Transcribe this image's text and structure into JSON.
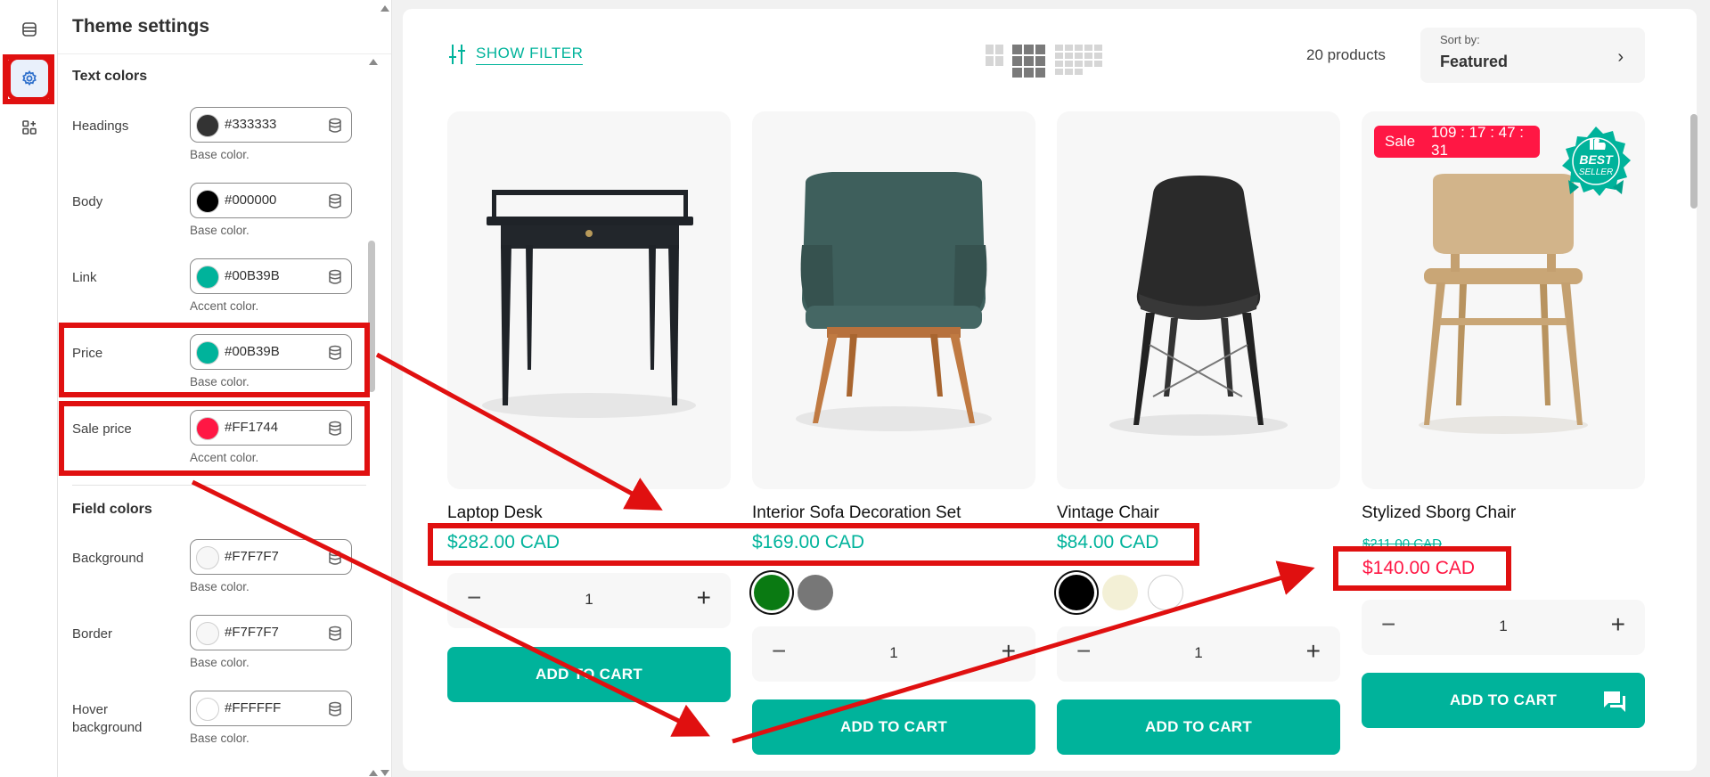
{
  "rail": {
    "icons": [
      "sections-icon",
      "theme-settings-icon",
      "app-blocks-icon"
    ]
  },
  "panel": {
    "title": "Theme settings",
    "text_colors_title": "Text colors",
    "text_colors": [
      {
        "label": "Headings",
        "value": "#333333",
        "hint": "Base color.",
        "color": "#333333"
      },
      {
        "label": "Body",
        "value": "#000000",
        "hint": "Base color.",
        "color": "#000000"
      },
      {
        "label": "Link",
        "value": "#00B39B",
        "hint": "Accent color.",
        "color": "#00B39B"
      },
      {
        "label": "Price",
        "value": "#00B39B",
        "hint": "Base color.",
        "color": "#00B39B"
      },
      {
        "label": "Sale price",
        "value": "#FF1744",
        "hint": "Accent color.",
        "color": "#FF1744"
      }
    ],
    "field_colors_title": "Field colors",
    "field_colors": [
      {
        "label": "Background",
        "value": "#F7F7F7",
        "hint": "Base color.",
        "color": "#F7F7F7"
      },
      {
        "label": "Border",
        "value": "#F7F7F7",
        "hint": "Base color.",
        "color": "#F7F7F7"
      },
      {
        "label": "Hover background",
        "value": "#FFFFFF",
        "hint": "Base color.",
        "color": "#FFFFFF"
      }
    ]
  },
  "toolbar": {
    "filter_label": "SHOW FILTER",
    "count": "20 products",
    "sort_label": "Sort by:",
    "sort_value": "Featured"
  },
  "products": [
    {
      "title": "Laptop Desk",
      "price": "$282.00 CAD",
      "qty": "1",
      "cta": "ADD TO CART"
    },
    {
      "title": "Interior Sofa Decoration Set",
      "price": "$169.00 CAD",
      "qty": "1",
      "cta": "ADD TO CART",
      "swatches": [
        "#0a7a12",
        "#777777"
      ]
    },
    {
      "title": "Vintage Chair",
      "price": "$84.00 CAD",
      "qty": "1",
      "cta": "ADD TO CART",
      "swatches": [
        "#000000",
        "#f3f0d6",
        "#ffffff"
      ]
    },
    {
      "title": "Stylized Sborg Chair",
      "old_price": "$211.00 CAD",
      "sale_price": "$140.00 CAD",
      "qty": "1",
      "cta": "ADD TO CART",
      "badge_label": "Sale",
      "countdown": "109 : 17 : 47 : 31",
      "best_seller_line1": "BEST",
      "best_seller_line2": "SELLER"
    }
  ],
  "colors": {
    "accent": "#00B39B",
    "sale": "#FF1744",
    "annotation": "#E01010"
  }
}
